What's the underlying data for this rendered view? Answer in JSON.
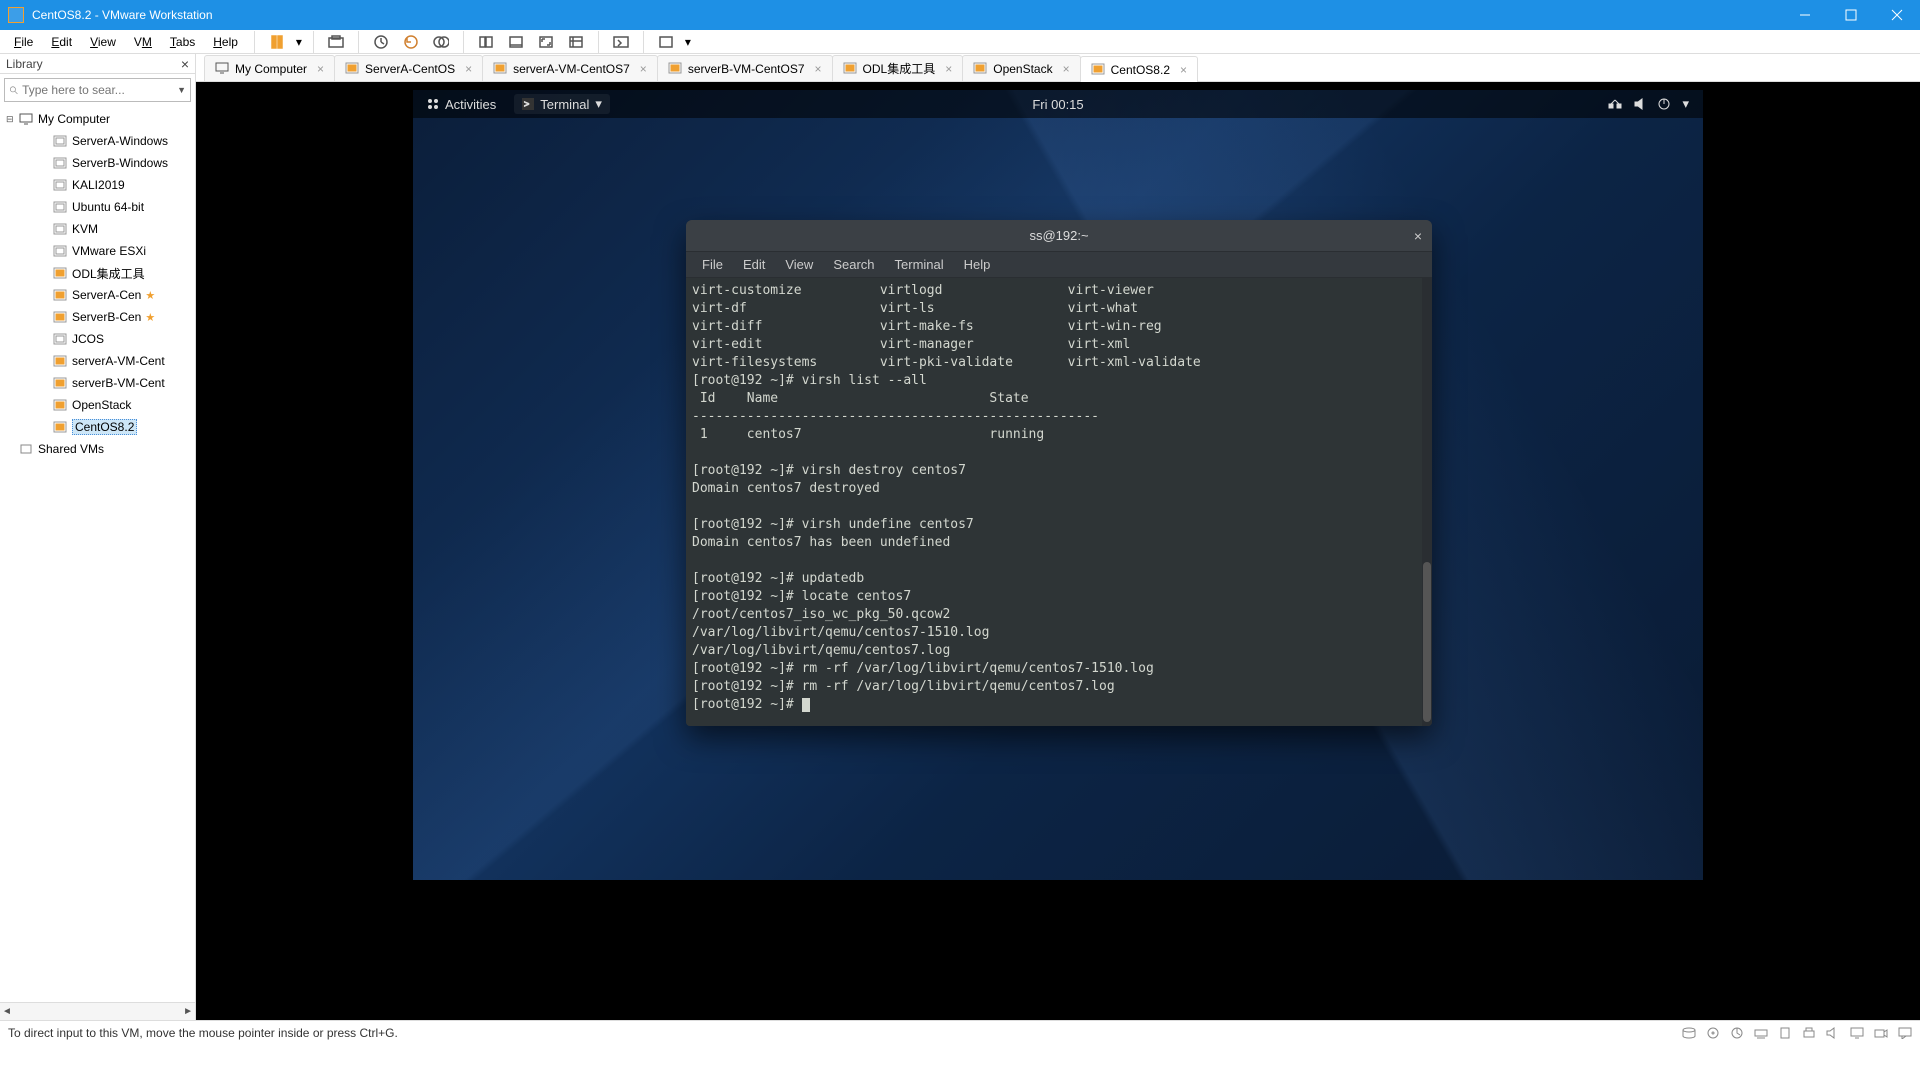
{
  "window": {
    "title": "CentOS8.2 - VMware Workstation"
  },
  "menubar": [
    "File",
    "Edit",
    "View",
    "VM",
    "Tabs",
    "Help"
  ],
  "library": {
    "header": "Library",
    "search_placeholder": "Type here to sear...",
    "root": "My Computer",
    "shared": "Shared VMs",
    "vms": [
      {
        "label": "ServerA-Windows",
        "on": false
      },
      {
        "label": "ServerB-Windows",
        "on": false
      },
      {
        "label": "KALI2019",
        "on": false
      },
      {
        "label": "Ubuntu 64-bit",
        "on": false
      },
      {
        "label": "KVM",
        "on": false
      },
      {
        "label": "VMware ESXi",
        "on": false
      },
      {
        "label": "ODL集成工具",
        "on": true
      },
      {
        "label": "ServerA-Cen",
        "on": true,
        "star": true
      },
      {
        "label": "ServerB-Cen",
        "on": true,
        "star": true
      },
      {
        "label": "JCOS",
        "on": false
      },
      {
        "label": "serverA-VM-Cent",
        "on": true
      },
      {
        "label": "serverB-VM-Cent",
        "on": true
      },
      {
        "label": "OpenStack",
        "on": true
      },
      {
        "label": "CentOS8.2",
        "on": true,
        "sel": true
      }
    ]
  },
  "tabs": [
    {
      "label": "My Computer",
      "icon": "host"
    },
    {
      "label": "ServerA-CentOS",
      "icon": "vm-on"
    },
    {
      "label": "serverA-VM-CentOS7",
      "icon": "vm-on"
    },
    {
      "label": "serverB-VM-CentOS7",
      "icon": "vm-on"
    },
    {
      "label": "ODL集成工具",
      "icon": "vm-on"
    },
    {
      "label": "OpenStack",
      "icon": "vm-on"
    },
    {
      "label": "CentOS8.2",
      "icon": "vm-on",
      "active": true
    }
  ],
  "guest": {
    "activities": "Activities",
    "app": "Terminal",
    "clock": "Fri 00:15",
    "term_title": "ss@192:~",
    "term_menu": [
      "File",
      "Edit",
      "View",
      "Search",
      "Terminal",
      "Help"
    ],
    "term_lines": [
      "virt-customize          virtlogd                virt-viewer",
      "virt-df                 virt-ls                 virt-what",
      "virt-diff               virt-make-fs            virt-win-reg",
      "virt-edit               virt-manager            virt-xml",
      "virt-filesystems        virt-pki-validate       virt-xml-validate",
      "[root@192 ~]# virsh list --all",
      " Id    Name                           State",
      "----------------------------------------------------",
      " 1     centos7                        running",
      "",
      "[root@192 ~]# virsh destroy centos7",
      "Domain centos7 destroyed",
      "",
      "[root@192 ~]# virsh undefine centos7",
      "Domain centos7 has been undefined",
      "",
      "[root@192 ~]# updatedb",
      "[root@192 ~]# locate centos7",
      "/root/centos7_iso_wc_pkg_50.qcow2",
      "/var/log/libvirt/qemu/centos7-1510.log",
      "/var/log/libvirt/qemu/centos7.log",
      "[root@192 ~]# rm -rf /var/log/libvirt/qemu/centos7-1510.log",
      "[root@192 ~]# rm -rf /var/log/libvirt/qemu/centos7.log",
      "[root@192 ~]# "
    ]
  },
  "statusbar": {
    "hint": "To direct input to this VM, move the mouse pointer inside or press Ctrl+G."
  }
}
